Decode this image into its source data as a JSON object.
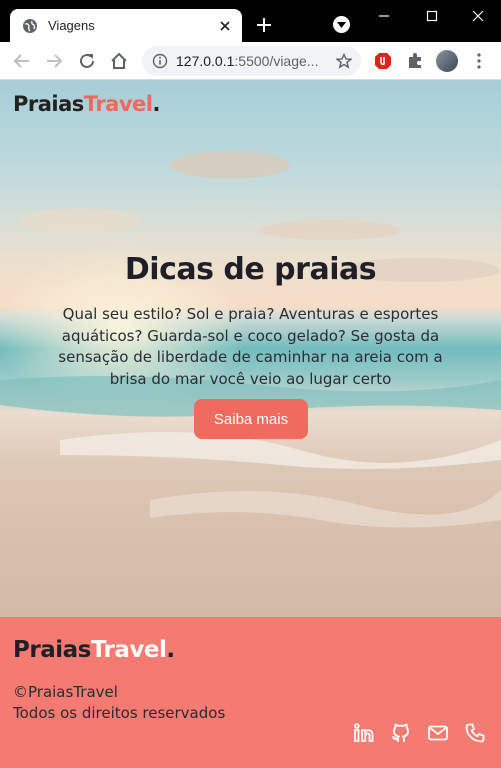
{
  "browser": {
    "tab_title": "Viagens",
    "url_host": "127.0.0.1",
    "url_rest": ":5500/viage..."
  },
  "site": {
    "logo_part1": "Praias",
    "logo_part2": "Travel",
    "logo_dot": "."
  },
  "hero": {
    "title": "Dicas de praias",
    "text": "Qual seu estilo? Sol e praia? Aventuras e esportes aquáticos? Guarda-sol e coco gelado? Se gosta da sensação de liberdade de caminhar na areia com a brisa do mar você veio ao lugar certo",
    "button_label": "Saiba mais"
  },
  "footer": {
    "copyright": "©PraiasTravel",
    "rights": "Todos os direitos reservados",
    "social": [
      "linkedin-icon",
      "github-icon",
      "mail-icon",
      "phone-icon"
    ]
  },
  "colors": {
    "accent": "#f16a60",
    "footer_bg": "#f37b71",
    "dark_text": "#1f1f27"
  }
}
